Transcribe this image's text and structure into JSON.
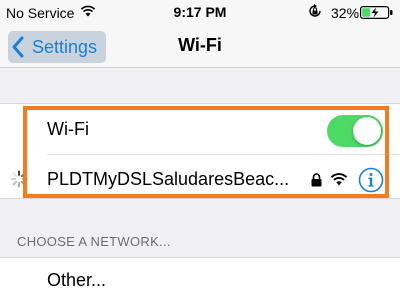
{
  "status_bar": {
    "carrier": "No Service",
    "time": "9:17 PM",
    "battery_percent": "32%",
    "battery_level": 0.32,
    "icons": [
      "wifi-icon",
      "orientation-lock-icon",
      "battery-charging-icon"
    ]
  },
  "nav": {
    "back_label": "Settings",
    "title": "Wi-Fi"
  },
  "wifi_section": {
    "toggle_label": "Wi-Fi",
    "toggle_on": true,
    "network": {
      "name": "PLDTMyDSLSaludaresBeac...",
      "secured": true,
      "icons": [
        "loading-spinner-icon",
        "lock-icon",
        "wifi-signal-icon",
        "info-icon"
      ]
    }
  },
  "choose_network": {
    "header": "CHOOSE A NETWORK...",
    "other_label": "Other..."
  },
  "colors": {
    "accent": "#1a7fd5",
    "toggle_on": "#4cd964",
    "highlight": "#f47b20",
    "background": "#efeff4"
  }
}
